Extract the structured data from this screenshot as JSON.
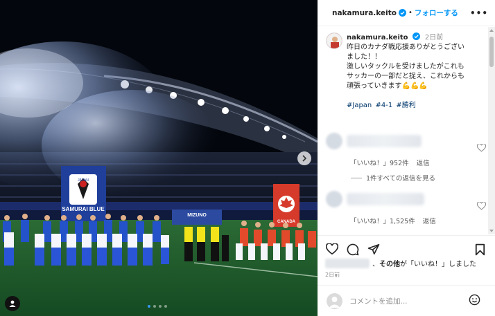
{
  "post": {
    "photo_banners": {
      "japan_flag_top": "JAPAN",
      "japan_flag_bottom": "SAMURAI BLUE",
      "canada_flag": "CANADA",
      "sponsor_banner": "MIZUNO"
    },
    "carousel": {
      "dots": 4,
      "active_index": 0
    }
  },
  "header": {
    "username": "nakamura.keito",
    "separator": "•",
    "follow_label": "フォローする",
    "more_label": "•••"
  },
  "caption": {
    "username": "nakamura.keito",
    "time": "2日前",
    "lines": [
      "昨日のカナダ戦応援ありがとうござい",
      "ました！！",
      "激しいタックルを受けましたがこれも",
      "サッカーの一部だと捉え、これからも",
      "頑張っていきます💪💪💪"
    ],
    "hashtags": [
      "#Japan",
      "#4-1",
      "#勝利"
    ]
  },
  "replies": [
    {
      "likes": "「いいね！」952件",
      "reply_label": "返信",
      "view_replies": "1件すべての返信を見る"
    },
    {
      "likes": "「いいね！」1,525件",
      "reply_label": "返信"
    }
  ],
  "likes_summary": {
    "others": "その他",
    "suffix": "が「いいね！」しました",
    "prefix": "、"
  },
  "posted_time": "2日前",
  "comment": {
    "placeholder": "コメントを追加..."
  },
  "colors": {
    "accent": "#0095f6",
    "hashtag": "#00376b",
    "japan_blue": "#1f3f9a",
    "canada_red": "#d63a2b"
  }
}
